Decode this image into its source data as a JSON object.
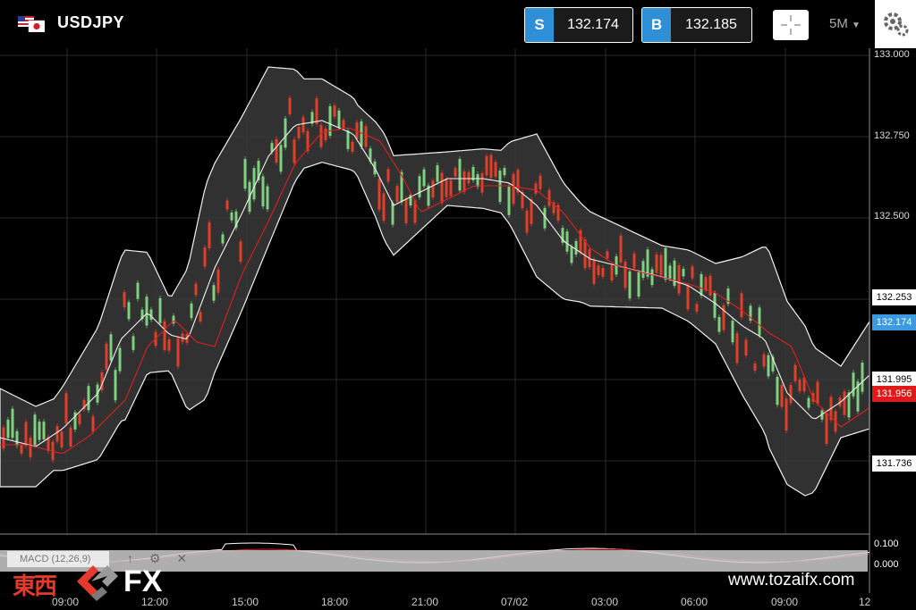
{
  "header": {
    "symbol": "USDJPY",
    "sell": {
      "tag": "S",
      "price": "132.174"
    },
    "buy": {
      "tag": "B",
      "price": "132.185"
    },
    "timeframe": "5M"
  },
  "price_axis": {
    "ticks": [
      "133.000",
      "132.750",
      "132.500",
      "132.253",
      "131.995",
      "131.736"
    ],
    "current_price": "132.174",
    "ma_price": "131.956",
    "macd_zero": "0.000",
    "macd_top": "0.100"
  },
  "macd": {
    "label": "MACD (12,26,9)"
  },
  "time_axis": {
    "labels": [
      "09:00",
      "12:00",
      "15:00",
      "18:00",
      "21:00",
      "07/02",
      "03:00",
      "06:00",
      "09:00",
      "12"
    ]
  },
  "watermark": {
    "kanji": "東西",
    "fx": "FX",
    "site": "www.tozaifx.com"
  },
  "colors": {
    "accent": "#2f8fd6",
    "bear": "#e0402a",
    "bull": "#7fd07f",
    "ma": "#e02020",
    "band": "#3a3a3a"
  }
}
